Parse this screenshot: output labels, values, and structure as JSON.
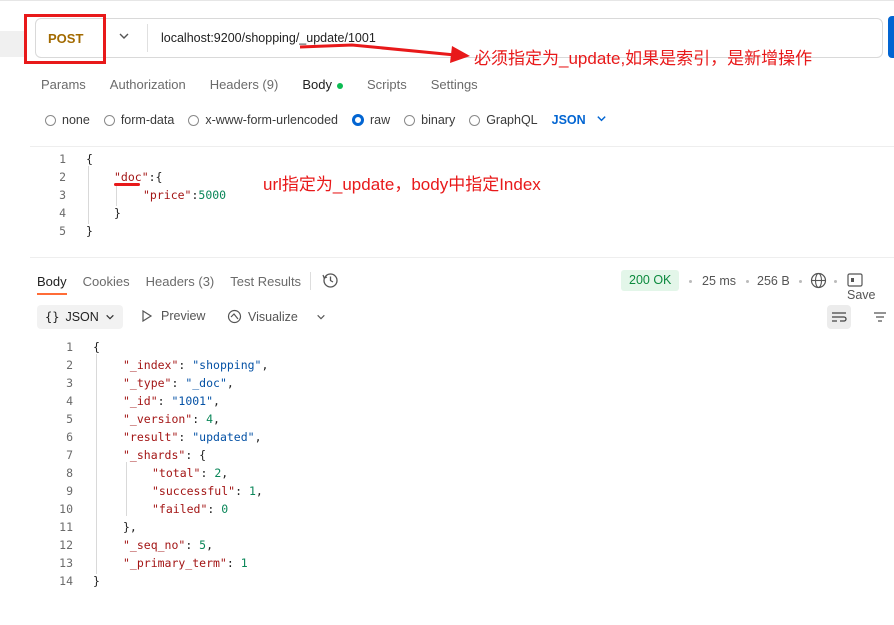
{
  "request": {
    "method": "POST",
    "url": "localhost:9200/shopping/_update/1001"
  },
  "annotations": {
    "url_note": "必须指定为_update,如果是索引，是新增操作",
    "body_note": "url指定为_update，body中指定Index"
  },
  "request_tabs": [
    {
      "label": "Params"
    },
    {
      "label": "Authorization"
    },
    {
      "label": "Headers (9)"
    },
    {
      "label": "Body"
    },
    {
      "label": "Scripts"
    },
    {
      "label": "Settings"
    }
  ],
  "body_types": [
    {
      "label": "none"
    },
    {
      "label": "form-data"
    },
    {
      "label": "x-www-form-urlencoded"
    },
    {
      "label": "raw",
      "checked": true
    },
    {
      "label": "binary"
    },
    {
      "label": "GraphQL"
    }
  ],
  "body_format": "JSON",
  "request_body": {
    "line_numbers": [
      "1",
      "2",
      "3",
      "4",
      "5"
    ],
    "doc_key": "\"doc\"",
    "price_key": "\"price\"",
    "price_value": "5000"
  },
  "response_tabs": [
    {
      "label": "Body"
    },
    {
      "label": "Cookies"
    },
    {
      "label": "Headers (3)"
    },
    {
      "label": "Test Results"
    }
  ],
  "response_meta": {
    "status": "200 OK",
    "time": "25 ms",
    "size": "256 B",
    "save_label": "Save"
  },
  "response_toolbar": {
    "format": "JSON",
    "preview": "Preview",
    "visualize": "Visualize"
  },
  "response_body": {
    "line_numbers": [
      "1",
      "2",
      "3",
      "4",
      "5",
      "6",
      "7",
      "8",
      "9",
      "10",
      "11",
      "12",
      "13",
      "14"
    ],
    "index": "\"shopping\"",
    "type": "\"_doc\"",
    "id": "\"1001\"",
    "version": "4",
    "result": "\"updated\"",
    "total": "2",
    "successful": "1",
    "failed": "0",
    "seq_no": "5",
    "primary_term": "1"
  },
  "colors": {
    "annotation_red": "#e8191a",
    "accent_blue": "#0265d2",
    "status_green": "#0c8a3e",
    "active_tab": "#ff6c37"
  }
}
